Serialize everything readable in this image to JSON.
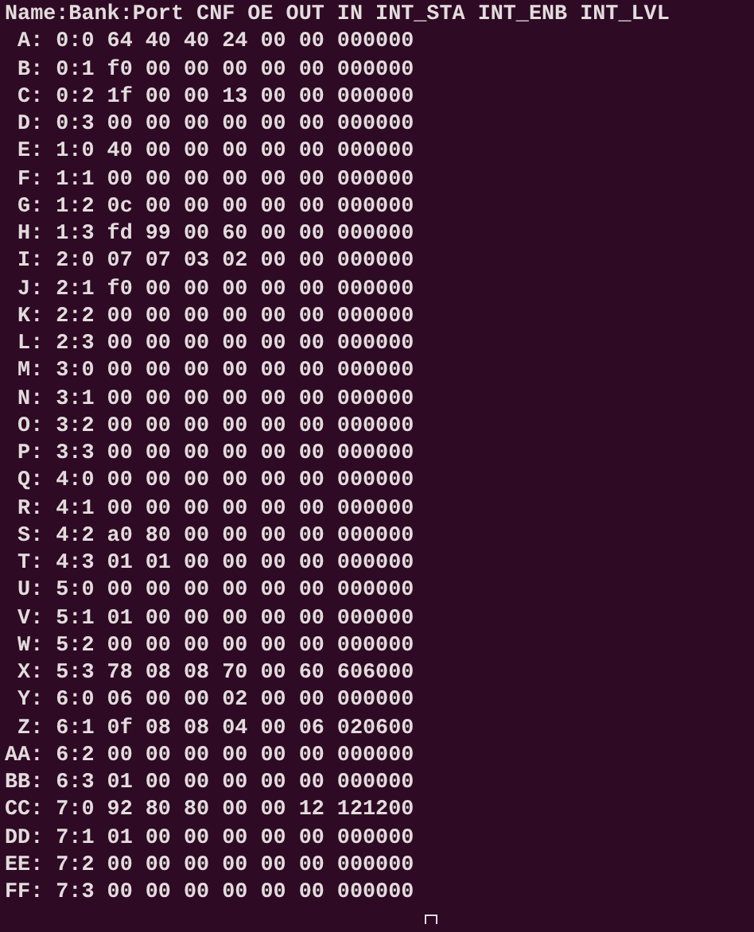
{
  "terminal": {
    "header": "Name:Bank:Port CNF OE OUT IN INT_STA INT_ENB INT_LVL",
    "lines": [
      " A: 0:0 64 40 40 24 00 00 000000",
      " B: 0:1 f0 00 00 00 00 00 000000",
      " C: 0:2 1f 00 00 13 00 00 000000",
      " D: 0:3 00 00 00 00 00 00 000000",
      " E: 1:0 40 00 00 00 00 00 000000",
      " F: 1:1 00 00 00 00 00 00 000000",
      " G: 1:2 0c 00 00 00 00 00 000000",
      " H: 1:3 fd 99 00 60 00 00 000000",
      " I: 2:0 07 07 03 02 00 00 000000",
      " J: 2:1 f0 00 00 00 00 00 000000",
      " K: 2:2 00 00 00 00 00 00 000000",
      " L: 2:3 00 00 00 00 00 00 000000",
      " M: 3:0 00 00 00 00 00 00 000000",
      " N: 3:1 00 00 00 00 00 00 000000",
      " O: 3:2 00 00 00 00 00 00 000000",
      " P: 3:3 00 00 00 00 00 00 000000",
      " Q: 4:0 00 00 00 00 00 00 000000",
      " R: 4:1 00 00 00 00 00 00 000000",
      " S: 4:2 a0 80 00 00 00 00 000000",
      " T: 4:3 01 01 00 00 00 00 000000",
      " U: 5:0 00 00 00 00 00 00 000000",
      " V: 5:1 01 00 00 00 00 00 000000",
      " W: 5:2 00 00 00 00 00 00 000000",
      " X: 5:3 78 08 08 70 00 60 606000",
      " Y: 6:0 06 00 00 02 00 00 000000",
      " Z: 6:1 0f 08 08 04 00 06 020600",
      "AA: 6:2 00 00 00 00 00 00 000000",
      "BB: 6:3 01 00 00 00 00 00 000000",
      "CC: 7:0 92 80 80 00 00 12 121200",
      "DD: 7:1 01 00 00 00 00 00 000000",
      "EE: 7:2 00 00 00 00 00 00 000000",
      "FF: 7:3 00 00 00 00 00 00 000000"
    ]
  }
}
